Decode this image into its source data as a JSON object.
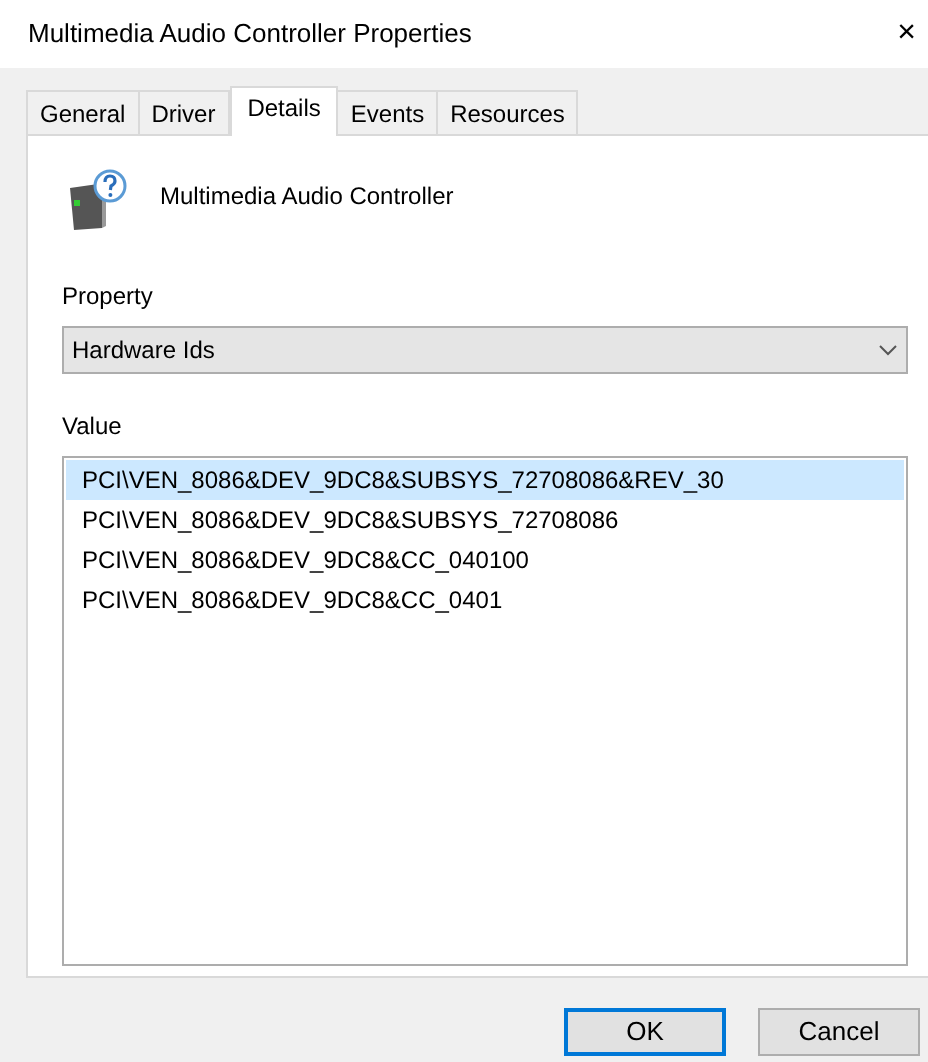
{
  "window": {
    "title": "Multimedia Audio Controller Properties",
    "close": "×"
  },
  "tabs": [
    {
      "label": "General",
      "selected": false
    },
    {
      "label": "Driver",
      "selected": false
    },
    {
      "label": "Details",
      "selected": true
    },
    {
      "label": "Events",
      "selected": false
    },
    {
      "label": "Resources",
      "selected": false
    }
  ],
  "device": {
    "name": "Multimedia Audio Controller"
  },
  "property": {
    "label": "Property",
    "value": "Hardware Ids"
  },
  "value": {
    "label": "Value",
    "items": [
      {
        "text": "PCI\\VEN_8086&DEV_9DC8&SUBSYS_72708086&REV_30",
        "selected": true
      },
      {
        "text": "PCI\\VEN_8086&DEV_9DC8&SUBSYS_72708086",
        "selected": false
      },
      {
        "text": "PCI\\VEN_8086&DEV_9DC8&CC_040100",
        "selected": false
      },
      {
        "text": "PCI\\VEN_8086&DEV_9DC8&CC_0401",
        "selected": false
      }
    ]
  },
  "buttons": [
    {
      "label": "OK",
      "default": true
    },
    {
      "label": "Cancel",
      "default": false
    }
  ]
}
